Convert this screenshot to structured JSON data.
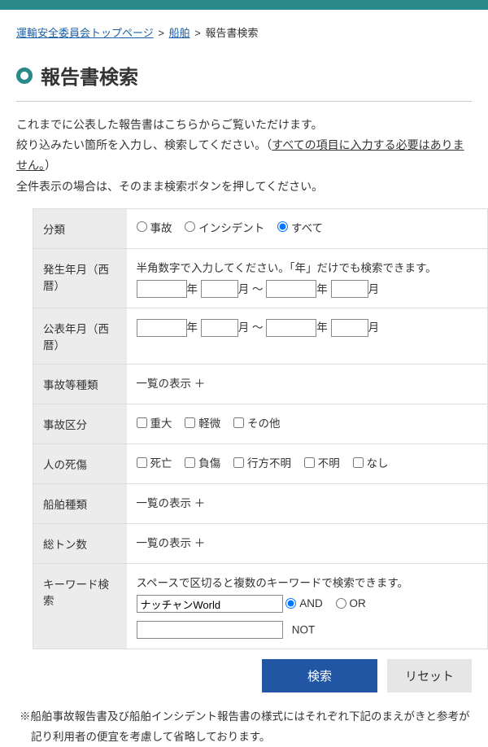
{
  "breadcrumb": {
    "home": "運輸安全委員会トップページ",
    "cat": "船舶",
    "current": "報告書検索"
  },
  "heading": "報告書検索",
  "intro": {
    "l1": "これまでに公表した報告書はこちらからご覧いただけます。",
    "l2a": "絞り込みたい箇所を入力し、検索してください。（",
    "l2b": "すべての項目に入力する必要はありません。",
    "l2c": "）",
    "l3": "全件表示の場合は、そのまま検索ボタンを押してください。"
  },
  "rows": {
    "bunrui": {
      "label": "分類",
      "opt1": "事故",
      "opt2": "インシデント",
      "opt3": "すべて"
    },
    "hassei": {
      "label": "発生年月（西暦）",
      "hint": "半角数字で入力してください。「年」だけでも検索できます。",
      "year": "年",
      "month": "月",
      "sep": "〜"
    },
    "kohyo": {
      "label": "公表年月（西暦）"
    },
    "jikoshurui": {
      "label": "事故等種類",
      "text": "一覧の表示",
      "plus": "＋"
    },
    "jikokubun": {
      "label": "事故区分",
      "opt1": "重大",
      "opt2": "軽微",
      "opt3": "その他"
    },
    "shisho": {
      "label": "人の死傷",
      "opt1": "死亡",
      "opt2": "負傷",
      "opt3": "行方不明",
      "opt4": "不明",
      "opt5": "なし"
    },
    "senpaku": {
      "label": "船舶種類",
      "text": "一覧の表示",
      "plus": "＋"
    },
    "ton": {
      "label": "総トン数",
      "text": "一覧の表示",
      "plus": "＋"
    },
    "keyword": {
      "label": "キーワード検索",
      "hint": "スペースで区切ると複数のキーワードで検索できます。",
      "value": "ナッチャンWorld",
      "and": "AND",
      "or": "OR",
      "not": "NOT"
    }
  },
  "buttons": {
    "search": "検索",
    "reset": "リセット"
  },
  "note": "※船舶事故報告書及び船舶インシデント報告書の様式にはそれぞれ下記のまえがきと参考が記り利用者の便宜を考慮して省略しております。"
}
